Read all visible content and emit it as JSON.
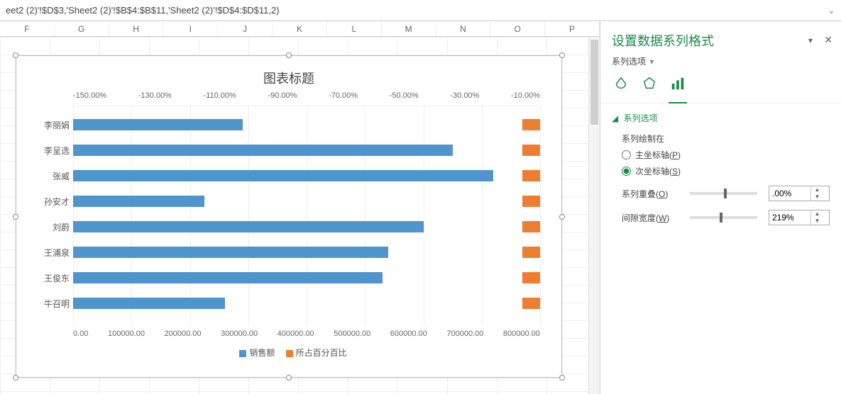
{
  "formula_bar": {
    "text": "eet2 (2)'!$D$3,'Sheet2 (2)'!$B$4:$B$11,'Sheet2 (2)'!$D$4:$D$11,2)"
  },
  "columns": [
    "F",
    "G",
    "H",
    "I",
    "J",
    "K",
    "L",
    "M",
    "N",
    "O",
    "P"
  ],
  "chart_data": {
    "type": "bar",
    "title": "图表标题",
    "categories": [
      "李丽娟",
      "李呈选",
      "张威",
      "孙安才",
      "刘蔚",
      "王浦泉",
      "王俊东",
      "牛召明"
    ],
    "series": [
      {
        "name": "销售额",
        "axis": "primary",
        "color": "#4f94cd",
        "values": [
          290000,
          650000,
          720000,
          225000,
          600000,
          540000,
          530000,
          260000
        ]
      },
      {
        "name": "所占百分百比",
        "axis": "secondary",
        "color": "#ed7d31",
        "values": [
          -6,
          -6,
          -6,
          -6,
          -6,
          -6,
          -6,
          -6
        ]
      }
    ],
    "primary_axis": {
      "min": 0,
      "max": 800000,
      "ticks": [
        "0.00",
        "100000.00",
        "200000.00",
        "300000.00",
        "400000.00",
        "500000.00",
        "600000.00",
        "700000.00",
        "800000.00"
      ],
      "position": "bottom"
    },
    "secondary_axis": {
      "min": -160,
      "max": 0,
      "ticks": [
        "-150.00%",
        "-130.00%",
        "-110.00%",
        "-90.00%",
        "-70.00%",
        "-50.00%",
        "-30.00%",
        "-10.00%"
      ],
      "position": "top"
    },
    "legend": {
      "position": "bottom",
      "items": [
        "销售额",
        "所占百分百比"
      ]
    }
  },
  "task_pane": {
    "title": "设置数据系列格式",
    "subtitle": "系列选项",
    "icons": {
      "fill": "fill",
      "effects": "effects",
      "series": "series",
      "active": "series"
    },
    "section": {
      "header": "系列选项",
      "plot_on_label": "系列绘制在",
      "radio_primary": {
        "label": "主坐标轴",
        "hotkey": "P",
        "checked": false
      },
      "radio_secondary": {
        "label": "次坐标轴",
        "hotkey": "S",
        "checked": true
      },
      "overlap": {
        "label": "系列重叠",
        "hotkey": "O",
        "value": ".00%",
        "pos": 50
      },
      "gap": {
        "label": "间隙宽度",
        "hotkey": "W",
        "value": "219%",
        "pos": 44
      }
    }
  }
}
